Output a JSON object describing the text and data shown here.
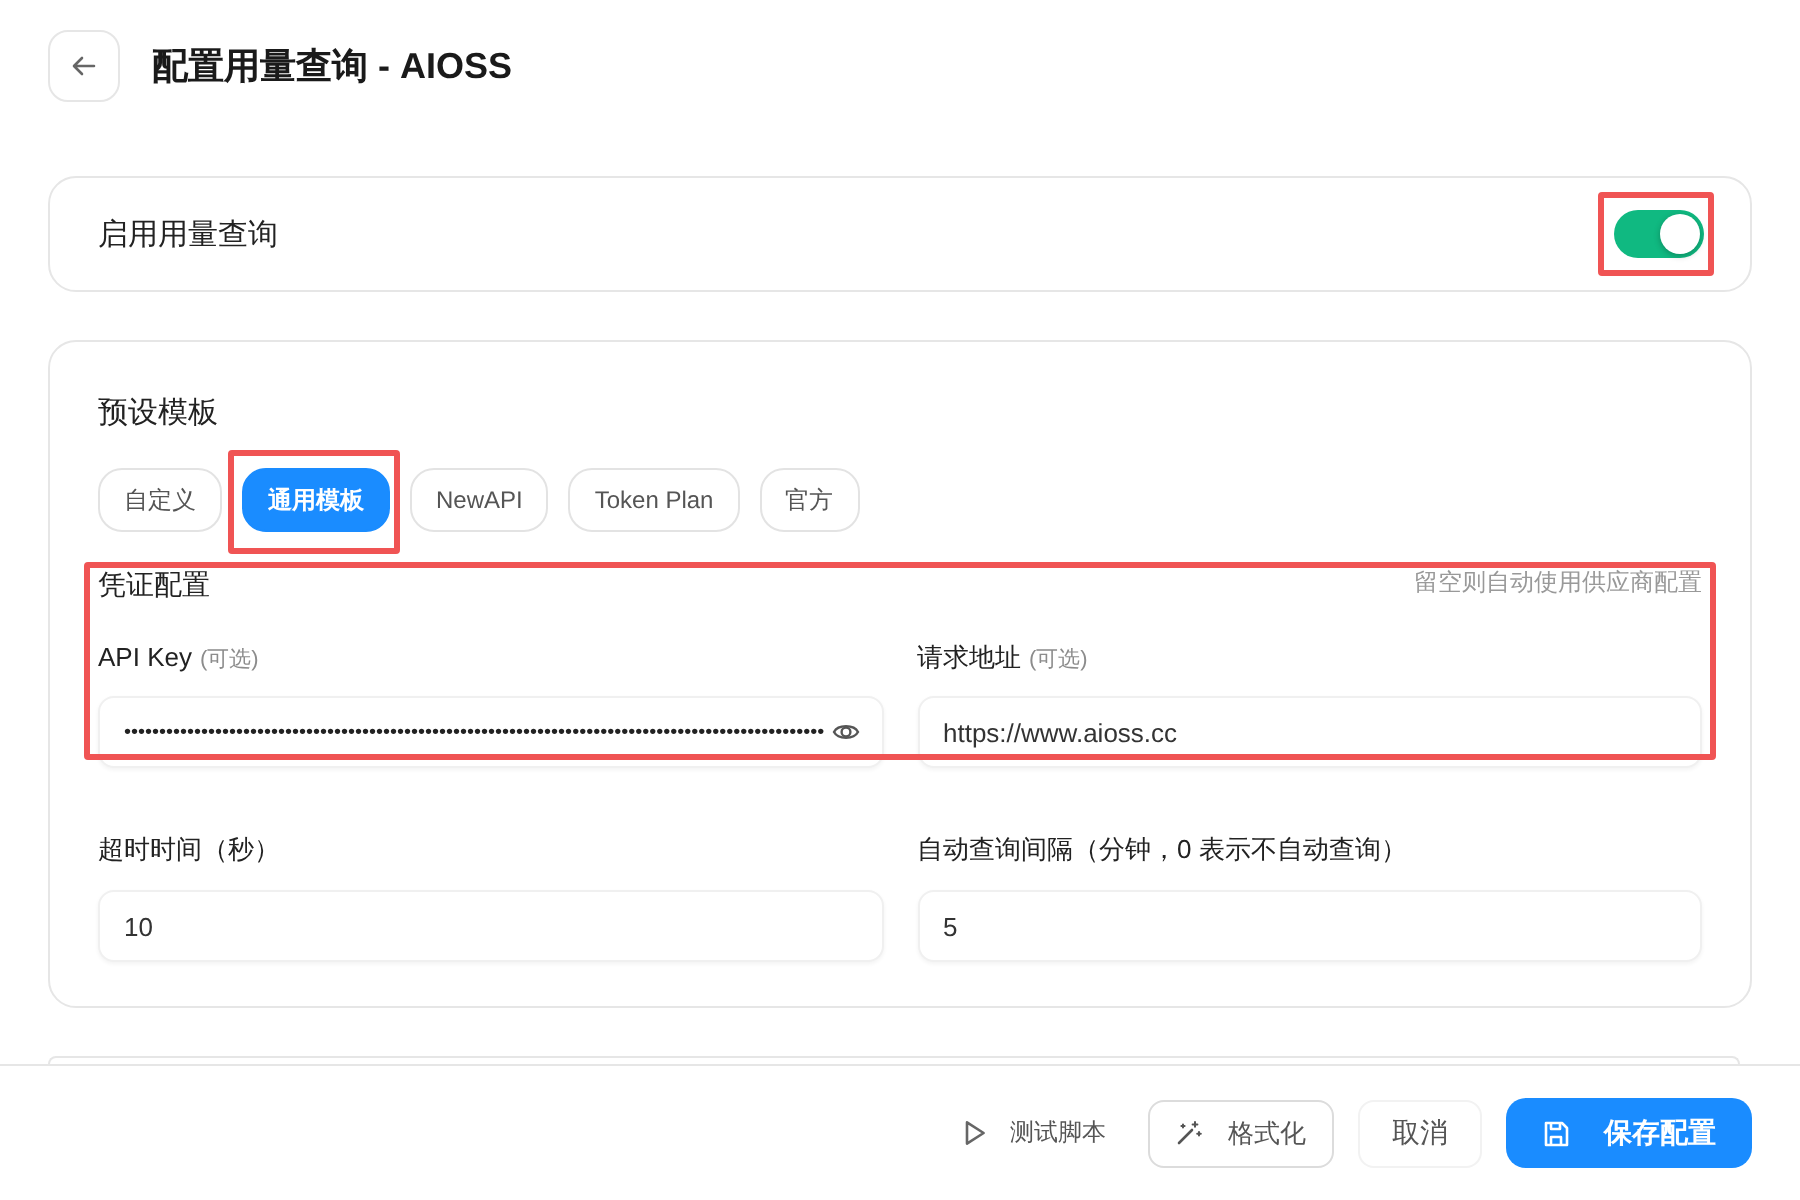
{
  "header": {
    "title": "配置用量查询 - AIOSS"
  },
  "enable_card": {
    "label": "启用用量查询",
    "toggle": {
      "on": true,
      "highlighted": true
    }
  },
  "template_card": {
    "title": "预设模板",
    "templates": [
      {
        "label": "自定义",
        "selected": false,
        "highlighted": false
      },
      {
        "label": "通用模板",
        "selected": true,
        "highlighted": true
      },
      {
        "label": "NewAPI",
        "selected": false,
        "highlighted": false
      },
      {
        "label": "Token Plan",
        "selected": false,
        "highlighted": false
      },
      {
        "label": "官方",
        "selected": false,
        "highlighted": false
      }
    ],
    "credentials": {
      "title": "凭证配置",
      "hint": "留空则自动使用供应商配置",
      "highlighted": true,
      "fields": [
        {
          "kind": "secret",
          "label": "API Key",
          "note": "(可选)",
          "value": "••••••••••••••••••••••••••••••••••••••••••••••••••••••••••••••••••••••••••••••••••••••••••••••••••••"
        },
        {
          "kind": "text",
          "label": "请求地址",
          "note": "(可选)",
          "value": "https://www.aioss.cc"
        }
      ]
    },
    "fields": [
      {
        "label": "超时时间（秒）",
        "value": "10"
      },
      {
        "label": "自动查询间隔（分钟，0 表示不自动查询）",
        "value": "5"
      }
    ]
  },
  "footer": {
    "buttons": [
      {
        "kind": "run",
        "label": "测试脚本"
      },
      {
        "kind": "format",
        "label": "格式化"
      },
      {
        "kind": "cancel",
        "label": "取消"
      },
      {
        "kind": "save",
        "label": "保存配置"
      }
    ]
  }
}
